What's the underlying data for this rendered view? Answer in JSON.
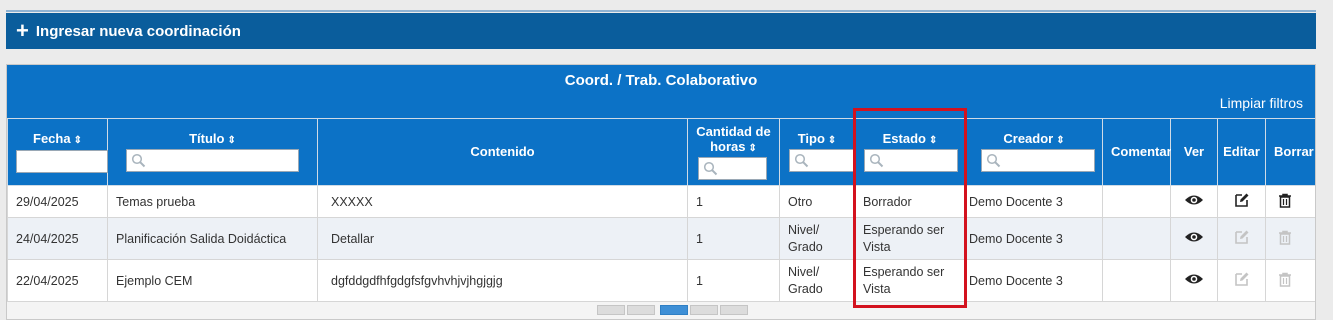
{
  "new_button": {
    "icon": "plus-icon",
    "label": "Ingresar nueva coordinación"
  },
  "panel": {
    "title": "Coord. / Trab. Colaborativo",
    "clear_filters": "Limpiar filtros"
  },
  "columns": {
    "fecha": "Fecha",
    "titulo": "Título",
    "contenido": "Contenido",
    "horas": "Cantidad de horas",
    "tipo": "Tipo",
    "estado": "Estado",
    "creador": "Creador",
    "comentarios": "Comentar",
    "ver": "Ver",
    "editar": "Editar",
    "borrar": "Borrar"
  },
  "rows": [
    {
      "fecha": "29/04/2025",
      "titulo": "Temas prueba",
      "contenido": "XXXXX",
      "horas": "1",
      "tipo": "Otro",
      "estado": "Borrador",
      "creador": "Demo Docente 3",
      "actions_enabled": true
    },
    {
      "fecha": "24/04/2025",
      "titulo": "Planificación Salida Doidáctica",
      "contenido": "Detallar",
      "horas": "1",
      "tipo": "Nivel/ Grado",
      "estado": "Esperando ser Vista",
      "creador": "Demo Docente 3",
      "actions_enabled": false
    },
    {
      "fecha": "22/04/2025",
      "titulo": "Ejemplo CEM",
      "contenido": "dgfddgdfhfgdgfsfgvhvhjvjhgjgjg",
      "horas": "1",
      "tipo": "Nivel/ Grado",
      "estado": "Esperando ser Vista",
      "creador": "Demo Docente 3",
      "actions_enabled": false
    }
  ],
  "colors": {
    "header_blue": "#0c72c6",
    "bar_blue": "#0a5d9c",
    "highlight_red": "#d3121e",
    "disabled_icon": "#c4c4c4"
  }
}
